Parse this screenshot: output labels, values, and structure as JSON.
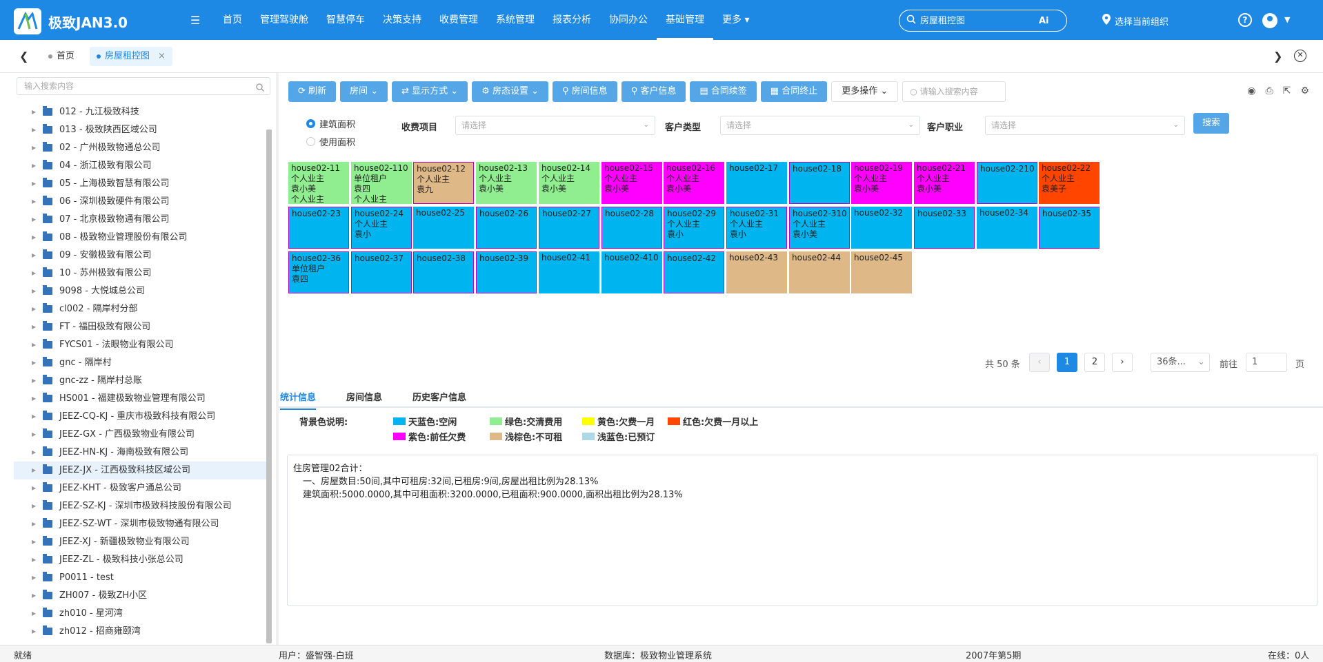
{
  "app": {
    "title": "极致JAN3.0"
  },
  "nav": {
    "items": [
      "首页",
      "管理驾驶舱",
      "智慧停车",
      "决策支持",
      "收费管理",
      "系统管理",
      "报表分析",
      "协同办公",
      "基础管理",
      "更多"
    ],
    "active_index": 8
  },
  "top_search": {
    "placeholder": "房屋租控图"
  },
  "org_picker": {
    "label": "选择当前组织"
  },
  "tabs": {
    "home": "首页",
    "current": "房屋租控图",
    "close": "×"
  },
  "sidebar": {
    "search_placeholder": "输入搜索内容",
    "items": [
      "012 - 九江极致科技",
      "013 - 极致陕西区域公司",
      "02 - 广州极致物通总公司",
      "04 - 浙江极致有限公司",
      "05 - 上海极致智慧有限公司",
      "06 - 深圳极致硬件有限公司",
      "07 - 北京极致物通有限公司",
      "08 - 极致物业管理股份有限公司",
      "09 - 安徽极致有限公司",
      "10 - 苏州极致有限公司",
      "9098 - 大悦城总公司",
      "cl002 - 隔岸村分部",
      "FT - 福田极致有限公司",
      "FYCS01 - 法眼物业有限公司",
      "gnc - 隔岸村",
      "gnc-zz - 隔岸村总账",
      "HS001 - 福建极致物业管理有限公司",
      "JEEZ-CQ-KJ - 重庆市极致科技有限公司",
      "JEEZ-GX - 广西极致物业有限公司",
      "JEEZ-HN-KJ - 海南极致有限公司",
      "JEEZ-JX - 江西极致科技区域公司",
      "JEEZ-KHT - 极致客户通总公司",
      "JEEZ-SZ-KJ - 深圳市极致科技股份有限公司",
      "JEEZ-SZ-WT - 深圳市极致物通有限公司",
      "JEEZ-XJ - 新疆极致物业有限公司",
      "JEEZ-ZL - 极致科技小张总公司",
      "P0011 - test",
      "ZH007 - 极致ZH小区",
      "zh010 - 星河湾",
      "zh012 - 招商雍颐湾"
    ],
    "selected_index": 20
  },
  "toolbar": {
    "refresh": "刷新",
    "room": "房间",
    "display_mode": "显示方式",
    "room_status": "房态设置",
    "room_info": "房间信息",
    "customer_info": "客户信息",
    "contract_renew": "合同续签",
    "contract_end": "合同终止",
    "more_ops": "更多操作",
    "search_placeholder": "请输入搜索内容"
  },
  "filters": {
    "radio_build": "建筑面积",
    "radio_use": "使用面积",
    "charge_item": "收费项目",
    "customer_type": "客户类型",
    "customer_job": "客户职业",
    "select_placeholder": "请选择",
    "search_btn": "搜索"
  },
  "colors": {
    "blue": "#00b4f0",
    "green": "#90ee90",
    "yellow": "#ffff00",
    "red": "#ff4500",
    "purple": "#ff00ff",
    "tan": "#deb887",
    "lightblue": "#add8e6"
  },
  "rooms": [
    {
      "lines": [
        "house02-11",
        "个人业主",
        "袁小美",
        "个人业主"
      ],
      "color": "#90ee90",
      "pborder": false
    },
    {
      "lines": [
        "house02-110",
        "单位租户",
        "袁四",
        "个人业主"
      ],
      "color": "#90ee90",
      "pborder": false
    },
    {
      "lines": [
        "house02-12",
        "个人业主",
        "袁九"
      ],
      "color": "#deb887",
      "pborder": true
    },
    {
      "lines": [
        "house02-13",
        "个人业主",
        "袁小美"
      ],
      "color": "#90ee90",
      "pborder": false
    },
    {
      "lines": [
        "house02-14",
        "个人业主",
        "袁小美"
      ],
      "color": "#90ee90",
      "pborder": false
    },
    {
      "lines": [
        "house02-15",
        "个人业主",
        "袁小美"
      ],
      "color": "#ff00ff",
      "pborder": false
    },
    {
      "lines": [
        "house02-16",
        "个人业主",
        "袁小美"
      ],
      "color": "#ff00ff",
      "pborder": false
    },
    {
      "lines": [
        "house02-17"
      ],
      "color": "#00b4f0",
      "pborder": false
    },
    {
      "lines": [
        "house02-18"
      ],
      "color": "#00b4f0",
      "pborder": true
    },
    {
      "lines": [
        "house02-19",
        "个人业主",
        "袁小美"
      ],
      "color": "#ff00ff",
      "pborder": false
    },
    {
      "lines": [
        "house02-21",
        "个人业主",
        "袁小美"
      ],
      "color": "#ff00ff",
      "pborder": false
    },
    {
      "lines": [
        "house02-210"
      ],
      "color": "#00b4f0",
      "pborder": true
    },
    {
      "lines": [
        "house02-22",
        "个人业主",
        "袁美子"
      ],
      "color": "#ff4500",
      "pborder": false
    },
    {
      "lines": [
        "house02-23"
      ],
      "color": "#00b4f0",
      "pborder": true
    },
    {
      "lines": [
        "house02-24",
        "个人业主",
        "袁小"
      ],
      "color": "#00b4f0",
      "pborder": true
    },
    {
      "lines": [
        "house02-25"
      ],
      "color": "#00b4f0",
      "pborder": false
    },
    {
      "lines": [
        "house02-26"
      ],
      "color": "#00b4f0",
      "pborder": true
    },
    {
      "lines": [
        "house02-27"
      ],
      "color": "#00b4f0",
      "pborder": true
    },
    {
      "lines": [
        "house02-28"
      ],
      "color": "#00b4f0",
      "pborder": true
    },
    {
      "lines": [
        "house02-29",
        "个人业主",
        "袁小"
      ],
      "color": "#00b4f0",
      "pborder": true
    },
    {
      "lines": [
        "house02-31",
        "个人业主",
        "袁小"
      ],
      "color": "#00b4f0",
      "pborder": true
    },
    {
      "lines": [
        "house02-310",
        "个人业主",
        "袁小美"
      ],
      "color": "#00b4f0",
      "pborder": true
    },
    {
      "lines": [
        "house02-32"
      ],
      "color": "#00b4f0",
      "pborder": false
    },
    {
      "lines": [
        "house02-33"
      ],
      "color": "#00b4f0",
      "pborder": true
    },
    {
      "lines": [
        "house02-34"
      ],
      "color": "#00b4f0",
      "pborder": false
    },
    {
      "lines": [
        "house02-35"
      ],
      "color": "#00b4f0",
      "pborder": true
    },
    {
      "lines": [
        "house02-36",
        "单位租户",
        "袁四"
      ],
      "color": "#00b4f0",
      "pborder": true
    },
    {
      "lines": [
        "house02-37"
      ],
      "color": "#00b4f0",
      "pborder": true
    },
    {
      "lines": [
        "house02-38"
      ],
      "color": "#00b4f0",
      "pborder": true
    },
    {
      "lines": [
        "house02-39"
      ],
      "color": "#00b4f0",
      "pborder": true
    },
    {
      "lines": [
        "house02-41"
      ],
      "color": "#00b4f0",
      "pborder": false
    },
    {
      "lines": [
        "house02-410"
      ],
      "color": "#00b4f0",
      "pborder": false
    },
    {
      "lines": [
        "house02-42"
      ],
      "color": "#00b4f0",
      "pborder": true
    },
    {
      "lines": [
        "house02-43"
      ],
      "color": "#deb887",
      "pborder": false
    },
    {
      "lines": [
        "house02-44"
      ],
      "color": "#deb887",
      "pborder": false
    },
    {
      "lines": [
        "house02-45"
      ],
      "color": "#deb887",
      "pborder": false
    }
  ],
  "pager": {
    "total": "共 50 条",
    "pages": [
      "1",
      "2"
    ],
    "active_page": "1",
    "size": "36条...",
    "goto": "前往",
    "goto_value": "1",
    "page_unit": "页"
  },
  "subtabs": [
    "统计信息",
    "房间信息",
    "历史客户信息"
  ],
  "legend": {
    "title": "背景色说明:",
    "items": [
      {
        "label": "天蓝色:空闲",
        "color": "#00b4f0"
      },
      {
        "label": "绿色:交清费用",
        "color": "#90ee90"
      },
      {
        "label": "黄色:欠费一月",
        "color": "#ffff00"
      },
      {
        "label": "红色:欠费一月以上",
        "color": "#ff4500"
      },
      {
        "label": "紫色:前任欠费",
        "color": "#ff00ff"
      },
      {
        "label": "浅棕色:不可租",
        "color": "#deb887"
      },
      {
        "label": "浅蓝色:已预订",
        "color": "#add8e6"
      }
    ]
  },
  "stats": {
    "line1": "住房管理02合计：",
    "line2": "一、房屋数目:50间,其中可租房:32间,已租房:9间,房屋出租比例为28.13%",
    "line3": "建筑面积:5000.0000,其中可租面积:3200.0000,已租面积:900.0000,面积出租比例为28.13%"
  },
  "statusbar": {
    "state": "就绪",
    "user": "用户：盛智强-白班",
    "db": "数据库：极致物业管理系统",
    "period": "2007年第5期",
    "online": "在线：0人"
  }
}
